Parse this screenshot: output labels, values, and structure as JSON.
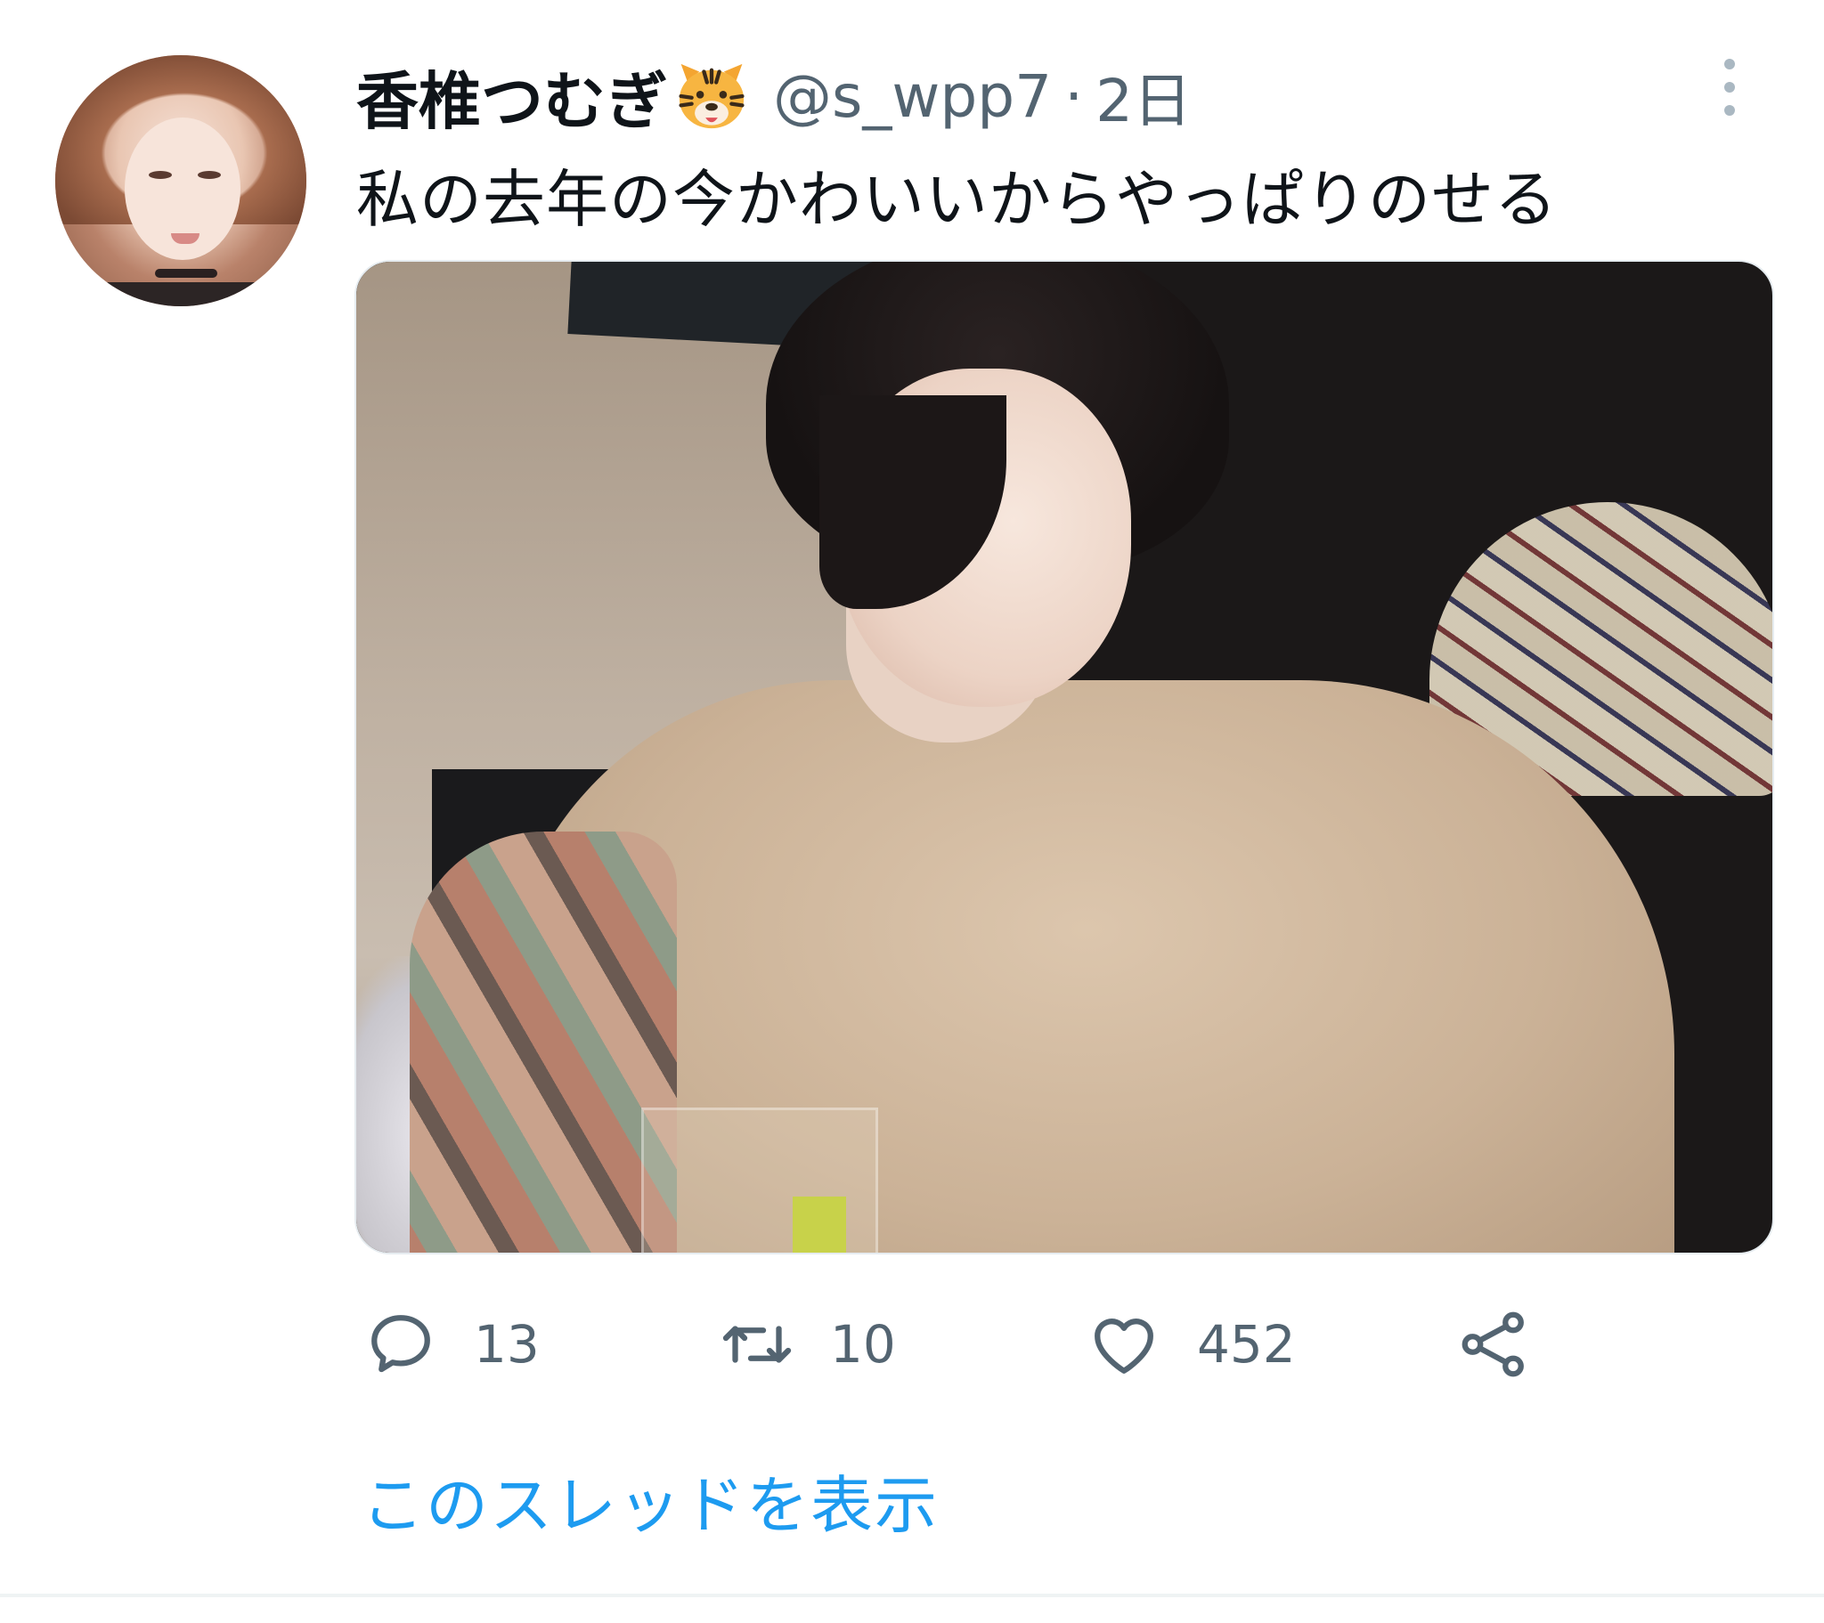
{
  "tweet": {
    "display_name": "香椎つむぎ",
    "name_emoji": "tiger-face-emoji",
    "handle": "@s_wpp7",
    "separator": "·",
    "time": "2日",
    "text": "私の去年の今かわいいからやっぱりのせる",
    "image_alt": "photo",
    "actions": {
      "reply_count": "13",
      "retweet_count": "10",
      "like_count": "452"
    },
    "thread_link": "このスレッドを表示"
  },
  "icons": {
    "reply": "speech-bubble-icon",
    "retweet": "retweet-arrows-icon",
    "like": "heart-icon",
    "share": "share-icon",
    "more": "vertical-dots-icon"
  },
  "colors": {
    "text": "#0f1419",
    "secondary": "#536471",
    "link": "#1d9bf0"
  }
}
